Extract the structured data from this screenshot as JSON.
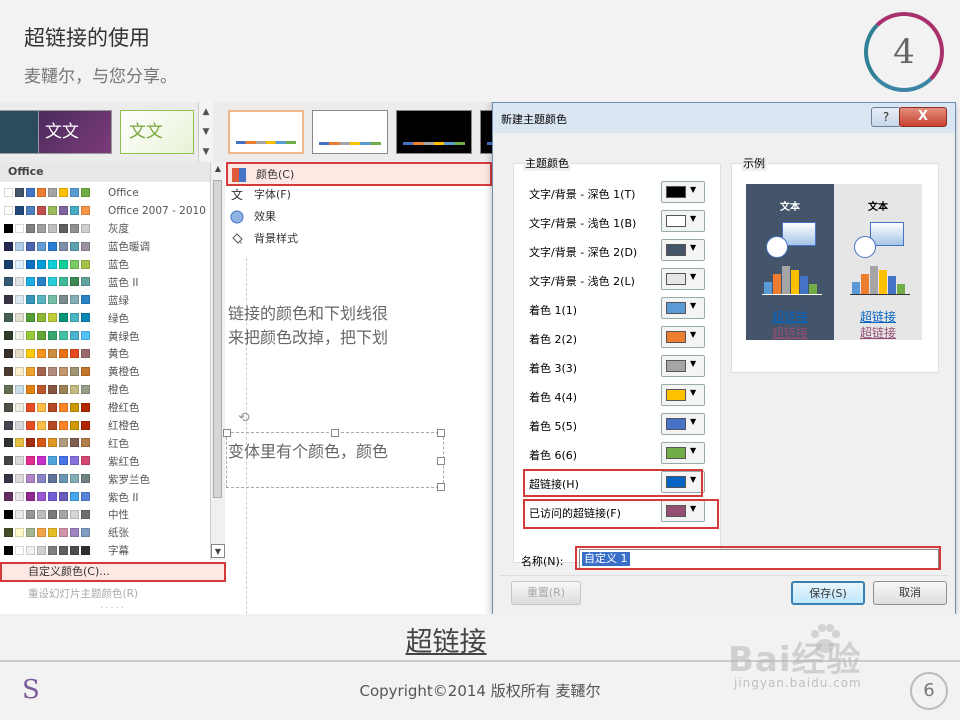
{
  "slide": {
    "title": "超链接的使用",
    "subtitle": "麦韆尔，与您分享。",
    "step_number": "4",
    "caption": "超链接",
    "copyright": "Copyright©2014  版权所有 麦韆尔",
    "page_number": "6",
    "footer_logo": "S",
    "watermark": "Bai经验",
    "watermark_url": "jingyan.baidu.com"
  },
  "gallery": {
    "thumb2_text": "文文",
    "thumb3_text": "文文"
  },
  "scheme_menu": {
    "header": "Office",
    "items": [
      {
        "name": "Office",
        "colors": [
          "#ffffff",
          "#44546a",
          "#4472c4",
          "#ed7d31",
          "#a5a5a5",
          "#ffc000",
          "#5b9bd5",
          "#70ad47"
        ]
      },
      {
        "name": "Office 2007 - 2010",
        "colors": [
          "#ffffff",
          "#1f497d",
          "#4f81bd",
          "#c0504d",
          "#9bbb59",
          "#8064a2",
          "#4bacc6",
          "#f79646"
        ]
      },
      {
        "name": "灰度",
        "colors": [
          "#000000",
          "#ffffff",
          "#808080",
          "#a0a0a0",
          "#c0c0c0",
          "#606060",
          "#909090",
          "#d0d0d0"
        ]
      },
      {
        "name": "蓝色暖调",
        "colors": [
          "#242852",
          "#acccea",
          "#4a66ac",
          "#629dd1",
          "#297fd5",
          "#7f8fa9",
          "#5aa2ae",
          "#9d90a0"
        ]
      },
      {
        "name": "蓝色",
        "colors": [
          "#17406d",
          "#dbefff",
          "#0f6fc6",
          "#009dd9",
          "#0bd0d9",
          "#10cf9b",
          "#7cca62",
          "#a5c249"
        ]
      },
      {
        "name": "蓝色 II",
        "colors": [
          "#335b74",
          "#dfe3e5",
          "#1cade4",
          "#2683c6",
          "#27ced7",
          "#42ba97",
          "#3e8853",
          "#62a39f"
        ]
      },
      {
        "name": "蓝绿",
        "colors": [
          "#373545",
          "#dbeaf1",
          "#3494ba",
          "#58b6c0",
          "#75bda7",
          "#7a8c8e",
          "#84acb6",
          "#2683c6"
        ]
      },
      {
        "name": "绿色",
        "colors": [
          "#455f51",
          "#e3ded1",
          "#549e39",
          "#8ab833",
          "#c0cf3a",
          "#029676",
          "#4ab5c4",
          "#0989b1"
        ]
      },
      {
        "name": "黄绿色",
        "colors": [
          "#2f3c2c",
          "#ecf0e9",
          "#99cb38",
          "#63a537",
          "#37a76f",
          "#44c1a3",
          "#4eb3cf",
          "#51c3f9"
        ]
      },
      {
        "name": "黄色",
        "colors": [
          "#39302a",
          "#e5dec5",
          "#ffca08",
          "#f8931d",
          "#ce8d3e",
          "#ec7016",
          "#e64823",
          "#9c6a6a"
        ]
      },
      {
        "name": "黄橙色",
        "colors": [
          "#4e3b30",
          "#fbeec9",
          "#f0a22e",
          "#a5644e",
          "#b58b80",
          "#c3986d",
          "#a19574",
          "#c17529"
        ]
      },
      {
        "name": "橙色",
        "colors": [
          "#637052",
          "#ccddea",
          "#e48312",
          "#bd582c",
          "#865640",
          "#9b8357",
          "#c2bc80",
          "#94a088"
        ]
      },
      {
        "name": "橙红色",
        "colors": [
          "#505046",
          "#eeece1",
          "#e84c22",
          "#ffbd47",
          "#b64926",
          "#ff8427",
          "#cc9900",
          "#b22600"
        ]
      },
      {
        "name": "红橙色",
        "colors": [
          "#454551",
          "#d8d9dc",
          "#e84c22",
          "#ffbd47",
          "#b64926",
          "#ff8427",
          "#cc9900",
          "#b22600"
        ]
      },
      {
        "name": "红色",
        "colors": [
          "#323232",
          "#e5c243",
          "#a5300f",
          "#d55816",
          "#e19825",
          "#b19c7d",
          "#7f5f52",
          "#b27d49"
        ]
      },
      {
        "name": "紫红色",
        "colors": [
          "#454545",
          "#dadada",
          "#e32d91",
          "#c830cc",
          "#4ea6dc",
          "#4775e7",
          "#8971e1",
          "#d54773"
        ]
      },
      {
        "name": "紫罗兰色",
        "colors": [
          "#373545",
          "#dcd8dc",
          "#ad84c6",
          "#8784c7",
          "#5d739a",
          "#6997af",
          "#84acb6",
          "#6f8183"
        ]
      },
      {
        "name": "紫色 II",
        "colors": [
          "#632e62",
          "#eae5eb",
          "#92278f",
          "#9b57d3",
          "#755dd9",
          "#665eb8",
          "#45a5ed",
          "#5982db"
        ]
      },
      {
        "name": "中性",
        "colors": [
          "#000000",
          "#e8e8e8",
          "#969696",
          "#bcbcbc",
          "#7b7b7b",
          "#a5a5a5",
          "#d6d6d6",
          "#6e6e6e"
        ]
      },
      {
        "name": "纸张",
        "colors": [
          "#444d26",
          "#fefac9",
          "#a5b592",
          "#f3a447",
          "#e7bc29",
          "#d092a7",
          "#9c85c0",
          "#809ec2"
        ]
      },
      {
        "name": "字幕",
        "colors": [
          "#000000",
          "#ffffff",
          "#f0f0f0",
          "#d0d0d0",
          "#808080",
          "#5f5f5f",
          "#4d4d4d",
          "#303030"
        ]
      }
    ],
    "custom_label": "自定义颜色(C)...",
    "reset_label": "重设幻灯片主题颜色(R)",
    "dots": "....."
  },
  "variant_menu": {
    "colors": "颜色(C)",
    "fonts": "字体(F)",
    "effects": "效果",
    "background": "背景样式",
    "fonts_icon": "文"
  },
  "slide_behind": {
    "line1": "链接的颜色和下划线很",
    "line2": "来把颜色改掉，把下划",
    "line3": "变体里有个颜色，颜色"
  },
  "dialog": {
    "title": "新建主题颜色",
    "help": "?",
    "close": "X",
    "group_label": "主题颜色",
    "sample_label": "示例",
    "rows": [
      {
        "label": "文字/背景 - 深色 1(T)",
        "color": "#000000"
      },
      {
        "label": "文字/背景 - 浅色 1(B)",
        "color": "#ffffff"
      },
      {
        "label": "文字/背景 - 深色 2(D)",
        "color": "#44546a"
      },
      {
        "label": "文字/背景 - 浅色 2(L)",
        "color": "#e7e6e6"
      },
      {
        "label": "着色 1(1)",
        "color": "#5b9bd5"
      },
      {
        "label": "着色 2(2)",
        "color": "#ed7d31"
      },
      {
        "label": "着色 3(3)",
        "color": "#a5a5a5"
      },
      {
        "label": "着色 4(4)",
        "color": "#ffc000"
      },
      {
        "label": "着色 5(5)",
        "color": "#4472c4"
      },
      {
        "label": "着色 6(6)",
        "color": "#70ad47"
      },
      {
        "label": "超链接(H)",
        "color": "#0563c1"
      },
      {
        "label": "已访问的超链接(F)",
        "color": "#954f72"
      }
    ],
    "sample_text": "文本",
    "sample_link": "超链接",
    "sample_visited": "超链接",
    "name_label": "名称(N):",
    "name_value": "自定义 1",
    "reset_btn": "重置(R)",
    "save_btn": "保存(S)",
    "cancel_btn": "取消"
  }
}
